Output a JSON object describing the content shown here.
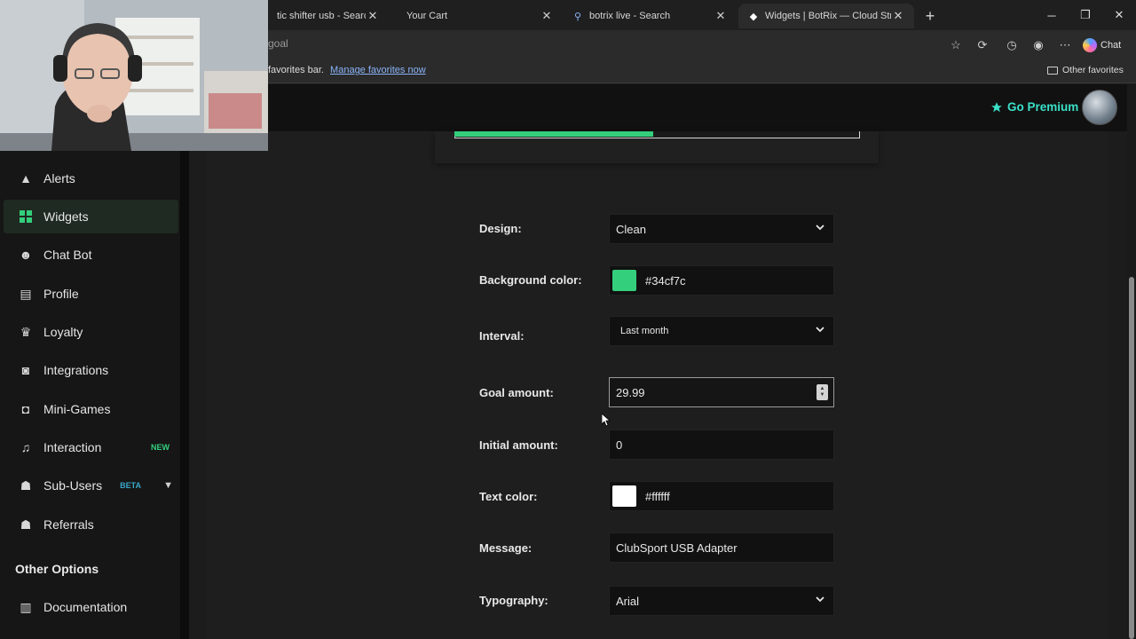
{
  "tabs": [
    {
      "title": "tic shifter usb - Search",
      "active": false
    },
    {
      "title": "Your Cart",
      "active": false
    },
    {
      "title": "botrix live - Search",
      "active": false
    },
    {
      "title": "Widgets | BotRix — Cloud Streami",
      "active": true
    }
  ],
  "address": {
    "url": "goal"
  },
  "toolbar": {
    "chat_label": "Chat"
  },
  "favorites": {
    "prompt": "favorites bar.",
    "manage_link": "Manage favorites now",
    "other": "Other favorites"
  },
  "header": {
    "premium_label": "Go Premium"
  },
  "sidebar": {
    "items": [
      {
        "label": "Alerts",
        "icon": "warning-icon",
        "active": false
      },
      {
        "label": "Widgets",
        "icon": "widgets-icon",
        "active": true
      },
      {
        "label": "Chat Bot",
        "icon": "robot-icon",
        "active": false
      },
      {
        "label": "Profile",
        "icon": "id-card-icon",
        "active": false
      },
      {
        "label": "Loyalty",
        "icon": "trophy-icon",
        "active": false
      },
      {
        "label": "Integrations",
        "icon": "discord-icon",
        "active": false
      },
      {
        "label": "Mini-Games",
        "icon": "gamepad-icon",
        "active": false
      },
      {
        "label": "Interaction",
        "icon": "music-icon",
        "active": false,
        "badge": "NEW"
      },
      {
        "label": "Sub-Users",
        "icon": "users-icon",
        "active": false,
        "badge": "BETA"
      },
      {
        "label": "Referrals",
        "icon": "user-group-icon",
        "active": false
      }
    ],
    "other_options_heading": "Other Options",
    "documentation": {
      "label": "Documentation",
      "icon": "scroll-icon"
    }
  },
  "goal_progress": {
    "fraction": 0.49,
    "color": "#34cf7c"
  },
  "form": {
    "design": {
      "label": "Design:",
      "value": "Clean"
    },
    "background_color": {
      "label": "Background color:",
      "value": "#34cf7c"
    },
    "interval": {
      "label": "Interval:",
      "value": "Last month"
    },
    "goal_amount": {
      "label": "Goal amount:",
      "value": "29.99"
    },
    "initial_amount": {
      "label": "Initial amount:",
      "value": "0"
    },
    "text_color": {
      "label": "Text color:",
      "value": "#ffffff"
    },
    "message": {
      "label": "Message:",
      "value": "ClubSport USB Adapter"
    },
    "typography": {
      "label": "Typography:",
      "value": "Arial"
    }
  },
  "colors": {
    "accent": "#34cf7c",
    "premium": "#3ae0c8",
    "new_badge": "#34cf7c",
    "beta_badge": "#3aa6c8"
  }
}
